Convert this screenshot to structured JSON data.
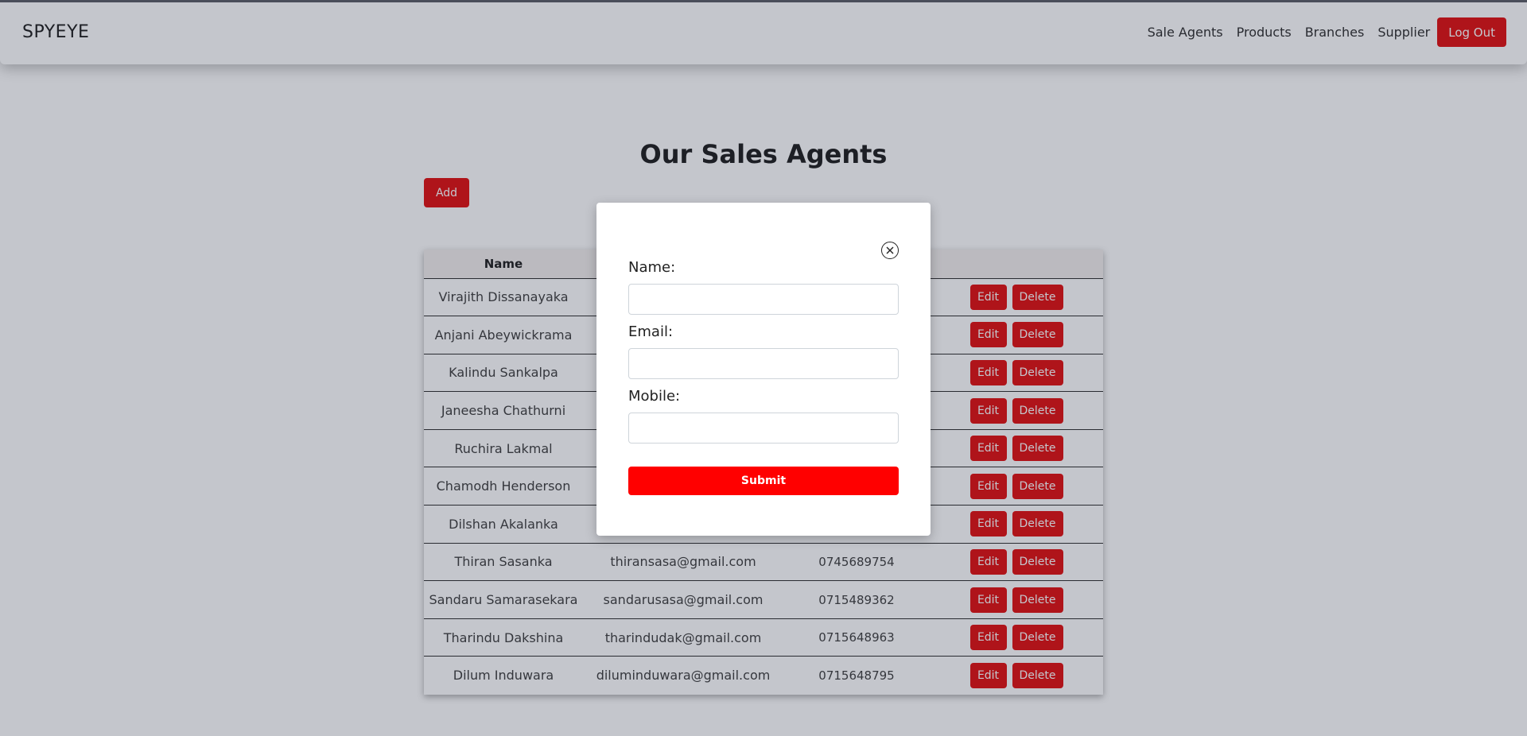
{
  "navbar": {
    "brand": "SPYEYE",
    "links": [
      "Sale Agents",
      "Products",
      "Branches",
      "Supplier"
    ],
    "logout_label": "Log Out"
  },
  "page": {
    "title": "Our Sales Agents",
    "add_label": "Add"
  },
  "table": {
    "headers": [
      "Name"
    ],
    "rows": [
      {
        "name": "Virajith Dissanayaka",
        "email": "",
        "mobile": ""
      },
      {
        "name": "Anjani Abeywickrama",
        "email": "",
        "mobile": ""
      },
      {
        "name": "Kalindu Sankalpa",
        "email": "",
        "mobile": ""
      },
      {
        "name": "Janeesha Chathurni",
        "email": "",
        "mobile": ""
      },
      {
        "name": "Ruchira Lakmal",
        "email": "",
        "mobile": ""
      },
      {
        "name": "Chamodh Henderson",
        "email": "",
        "mobile": ""
      },
      {
        "name": "Dilshan Akalanka",
        "email": "",
        "mobile": ""
      },
      {
        "name": "Thiran Sasanka",
        "email": "thiransasa@gmail.com",
        "mobile": "0745689754"
      },
      {
        "name": "Sandaru Samarasekara",
        "email": "sandarusasa@gmail.com",
        "mobile": "0715489362"
      },
      {
        "name": "Tharindu Dakshina",
        "email": "tharindudak@gmail.com",
        "mobile": "0715648963"
      },
      {
        "name": "Dilum Induwara",
        "email": "diluminduwara@gmail.com",
        "mobile": "0715648795"
      }
    ],
    "edit_label": "Edit",
    "delete_label": "Delete"
  },
  "modal": {
    "name_label": "Name:",
    "email_label": "Email:",
    "mobile_label": "Mobile:",
    "name_value": "",
    "email_value": "",
    "mobile_value": "",
    "submit_label": "Submit",
    "close_icon": "close-circle-icon"
  },
  "colors": {
    "accent_red": "#e10000",
    "submit_red": "#ff0000"
  }
}
